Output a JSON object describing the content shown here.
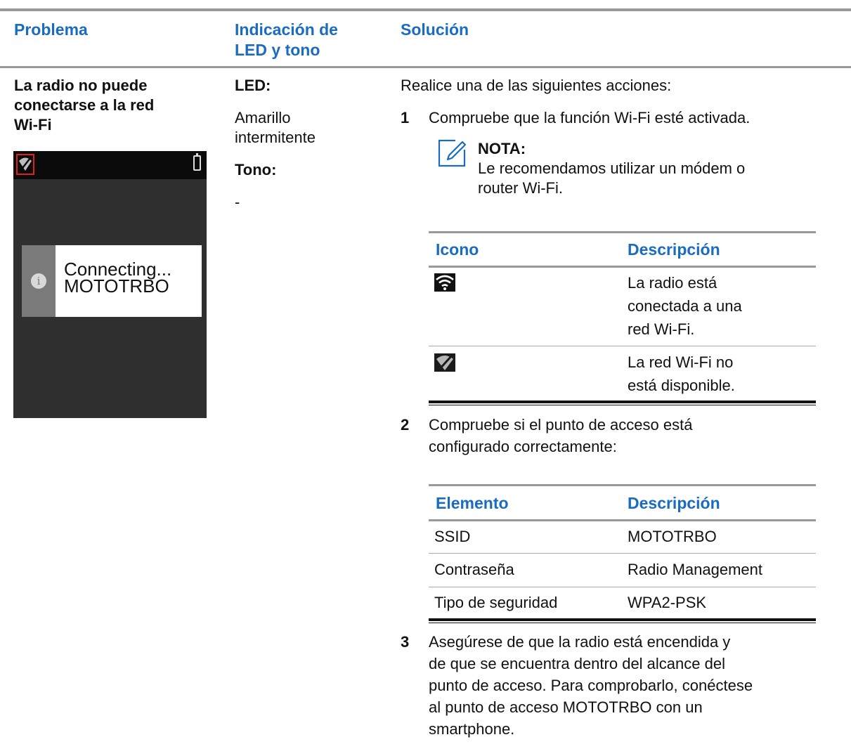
{
  "headers": {
    "problem": "Problema",
    "indication_line1": "Indicación de",
    "indication_line2": "LED y tono",
    "solution": "Solución"
  },
  "problem": {
    "line1": "La radio no puede",
    "line2": "conectarse a la red",
    "line3": "Wi-Fi",
    "screen": {
      "status_icons": [
        "wifi-unavailable-icon",
        "battery-icon"
      ],
      "info_icon": "info-icon",
      "info_glyph": "i",
      "message_line1": "Connecting...",
      "message_line2": "MOTOTRBO"
    }
  },
  "indication": {
    "led_label": "LED:",
    "led_value_line1": "Amarillo",
    "led_value_line2": "intermitente",
    "tone_label": "Tono:",
    "tone_value": "-"
  },
  "solution": {
    "intro": "Realice una de las siguientes acciones:",
    "steps": [
      {
        "num": "1",
        "lines": [
          "Compruebe que la función Wi-Fi esté activada."
        ]
      },
      {
        "num": "2",
        "lines": [
          "Compruebe si el punto de acceso está",
          "configurado correctamente:"
        ]
      },
      {
        "num": "3",
        "lines": [
          "Asegúrese de que la radio está encendida y",
          "de que se encuentra dentro del alcance del",
          "punto de acceso. Para comprobarlo, conéctese",
          "al punto de acceso MOTOTRBO con un",
          "smartphone."
        ]
      }
    ],
    "note": {
      "icon": "note-pencil-icon",
      "title": "NOTA:",
      "line1": "Le recomendamos utilizar un módem o",
      "line2": "router Wi-Fi."
    },
    "icon_table": {
      "headers": [
        "Icono",
        "Descripción"
      ],
      "rows": [
        {
          "icon": "wifi-connected-icon",
          "lines": [
            "La radio está",
            "conectada a una",
            "red Wi-Fi."
          ]
        },
        {
          "icon": "wifi-unavailable-icon",
          "lines": [
            "La red Wi-Fi no",
            "está disponible."
          ]
        }
      ]
    },
    "ap_table": {
      "headers": [
        "Elemento",
        "Descripción"
      ],
      "rows": [
        [
          "SSID",
          "MOTOTRBO"
        ],
        [
          "Contraseña",
          "Radio Management"
        ],
        [
          "Tipo de seguridad",
          "WPA2-PSK"
        ]
      ]
    }
  }
}
